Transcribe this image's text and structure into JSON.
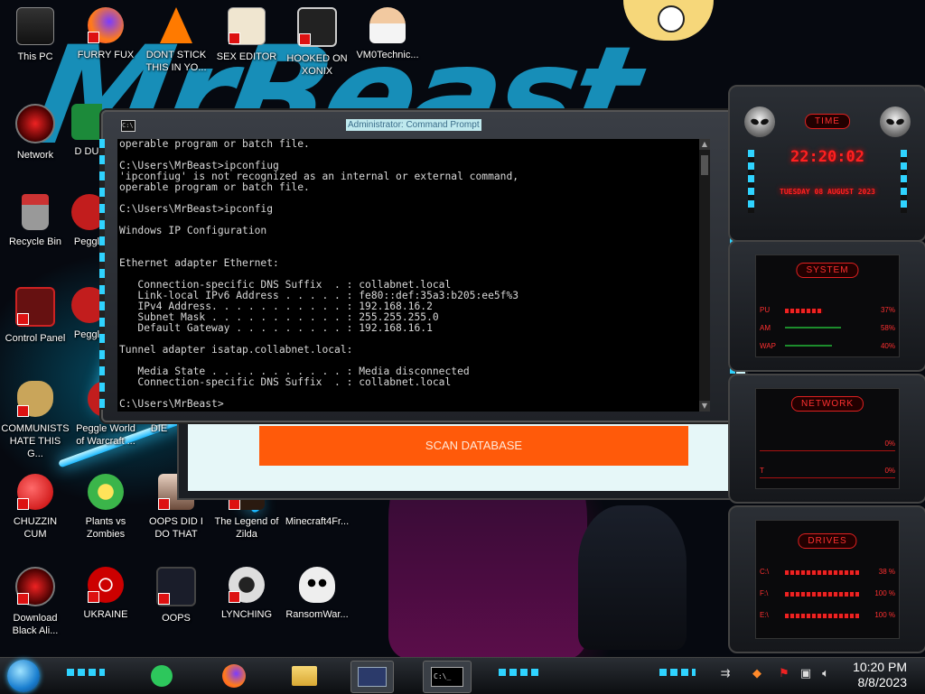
{
  "desktop": {
    "icons": [
      {
        "label": "This PC"
      },
      {
        "label": "FURRY FUX"
      },
      {
        "label": "DONT STICK THIS IN YO..."
      },
      {
        "label": "SEX EDITOR"
      },
      {
        "label": "HOOKED ON XONIX"
      },
      {
        "label": "VM0Technic..."
      },
      {
        "label": "Network"
      },
      {
        "label": "D DU"
      },
      {
        "label": "Recycle Bin"
      },
      {
        "label": "Peggl"
      },
      {
        "label": "Control Panel"
      },
      {
        "label": "Peggl"
      },
      {
        "label": "COMMUNISTS HATE THIS G..."
      },
      {
        "label": "Peggle World of Warcraft ..."
      },
      {
        "label": "DIE"
      },
      {
        "label": "CHUZZIN CUM"
      },
      {
        "label": "Plants vs Zombies"
      },
      {
        "label": "OOPS DID I DO THAT"
      },
      {
        "label": "The Legend of Zilda"
      },
      {
        "label": "Minecraft4Fr..."
      },
      {
        "label": "Download Black Ali..."
      },
      {
        "label": "UKRAINE"
      },
      {
        "label": "OOPS"
      },
      {
        "label": "LYNCHING"
      },
      {
        "label": "RansomWar..."
      }
    ]
  },
  "cmd_window": {
    "title": "Administrator: Command Prompt",
    "icon_text": "C:\\",
    "scroll_up": "▲",
    "scroll_down": "▼",
    "lines": [
      "operable program or batch file.",
      "",
      "C:\\Users\\MrBeast>ipconfiug",
      "'ipconfiug' is not recognized as an internal or external command,",
      "operable program or batch file.",
      "",
      "C:\\Users\\MrBeast>ipconfig",
      "",
      "Windows IP Configuration",
      "",
      "",
      "Ethernet adapter Ethernet:",
      "",
      "   Connection-specific DNS Suffix  . : collabnet.local",
      "   Link-local IPv6 Address . . . . . : fe80::def:35a3:b205:ee5f%3",
      "   IPv4 Address. . . . . . . . . . . : 192.168.16.2",
      "   Subnet Mask . . . . . . . . . . . : 255.255.255.0",
      "   Default Gateway . . . . . . . . . : 192.168.16.1",
      "",
      "Tunnel adapter isatap.collabnet.local:",
      "",
      "   Media State . . . . . . . . . . . : Media disconnected",
      "   Connection-specific DNS Suffix  . : collabnet.local",
      "",
      "C:\\Users\\MrBeast>"
    ]
  },
  "scan_app": {
    "button_label": "SCAN DATABASE"
  },
  "gadgets": {
    "time": {
      "title": "TIME",
      "clock": "22:20:02",
      "date": "TUESDAY 08 AUGUST 2023"
    },
    "system": {
      "title": "SYSTEM",
      "rows": [
        {
          "key": "PU",
          "value": "37%"
        },
        {
          "key": "AM",
          "value": "58%"
        },
        {
          "key": "WAP",
          "value": "40%"
        }
      ]
    },
    "network": {
      "title": "NETWORK",
      "rows": [
        {
          "key": "",
          "value": "0%"
        },
        {
          "key": "T",
          "value": "0%"
        }
      ]
    },
    "drives": {
      "title": "DRIVES",
      "rows": [
        {
          "key": "C:\\",
          "value": "38 %"
        },
        {
          "key": "F:\\",
          "value": "100 %"
        },
        {
          "key": "E:\\",
          "value": "100 %"
        }
      ]
    }
  },
  "taskbar": {
    "clock_time": "10:20 PM",
    "clock_date": "8/8/2023",
    "terminal_text": "C:\\_"
  },
  "colors": {
    "accent_cyan": "#2fd3ff",
    "gadget_red": "#ff2020",
    "scan_button": "#ff5a0a"
  }
}
